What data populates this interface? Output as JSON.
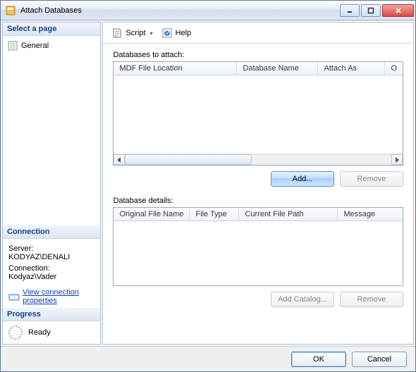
{
  "window": {
    "title": "Attach Databases"
  },
  "sidebar": {
    "select_page_header": "Select a page",
    "items": [
      {
        "label": "General"
      }
    ],
    "connection_header": "Connection",
    "server_label": "Server:",
    "server_value": "KODYAZ\\DENALI",
    "connection_label": "Connection:",
    "connection_value": "Kodyaz\\Vader",
    "view_props": "View connection properties",
    "progress_header": "Progress",
    "progress_status": "Ready"
  },
  "toolbar": {
    "script": "Script",
    "help": "Help"
  },
  "main": {
    "databases_to_attach": "Databases to attach:",
    "grid1_cols": {
      "c1": "MDF File Location",
      "c2": "Database Name",
      "c3": "Attach As",
      "c4": "O"
    },
    "add_btn": "Add...",
    "remove_btn_top": "Remove",
    "database_details": "Database details:",
    "grid2_cols": {
      "d1": "Original File Name",
      "d2": "File Type",
      "d3": "Current File Path",
      "d4": "Message"
    },
    "add_catalog_btn": "Add Catalog...",
    "remove_btn_bottom": "Remove"
  },
  "footer": {
    "ok": "OK",
    "cancel": "Cancel"
  }
}
